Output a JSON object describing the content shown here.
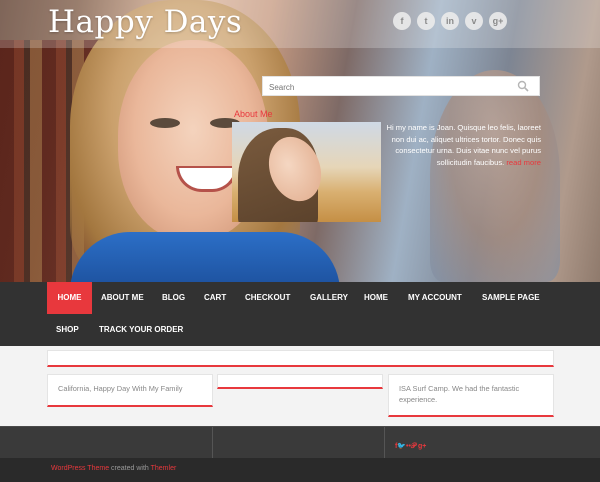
{
  "site": {
    "title": "Happy Days"
  },
  "social": [
    {
      "icon": "facebook-icon",
      "glyph": "f"
    },
    {
      "icon": "tumblr-icon",
      "glyph": "t"
    },
    {
      "icon": "linkedin-icon",
      "glyph": "in"
    },
    {
      "icon": "vimeo-icon",
      "glyph": "v"
    },
    {
      "icon": "google-plus-icon",
      "glyph": "g+"
    }
  ],
  "search": {
    "placeholder": "Search"
  },
  "about": {
    "title": "About Me",
    "text": "Hi my name is Joan.  Quisque leo felis, laoreet non dui ac, aliquet ultrices tortor. Donec quis consectetur urna. Duis vitae nunc vel purus sollicitudin faucibus.",
    "more_label": "read more"
  },
  "nav": {
    "items": [
      {
        "label": "Home",
        "active": true
      },
      {
        "label": "About Me"
      },
      {
        "label": "Blog"
      },
      {
        "label": "Cart"
      },
      {
        "label": "Checkout"
      },
      {
        "label": "Gallery"
      },
      {
        "label": "Home"
      },
      {
        "label": "My account"
      },
      {
        "label": "Sample Page"
      },
      {
        "label": "Shop"
      },
      {
        "label": "Track your order"
      }
    ]
  },
  "cards": {
    "left": "California, Happy Day With My Family",
    "middle": "",
    "right": "ISA Surf Camp. We had the fantastic experience."
  },
  "footer": {
    "social_glyphs": "f🐦••𝒫 g+",
    "credit_link": "WordPress Theme",
    "credit_mid": " created with ",
    "credit_author": "Themler"
  },
  "colors": {
    "accent": "#e8383d",
    "nav_bg": "#323232",
    "footer_bg": "#3a3a3a"
  }
}
